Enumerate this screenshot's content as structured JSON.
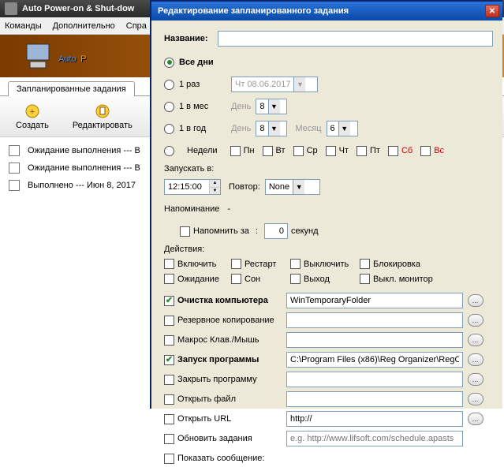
{
  "backWindow": {
    "title": "Auto Power-on & Shut-dow",
    "menu": [
      "Команды",
      "Дополнительно",
      "Спра"
    ],
    "bannerText": "Auto",
    "bannerTail": "P",
    "tabLabel": "Запланированные задания",
    "toolbar": {
      "create": "Создать",
      "edit": "Редактировать"
    },
    "listRows": [
      "Ожидание выполнения --- В",
      "Ожидание выполнения --- В",
      "Выполнено --- Июн 8,  2017"
    ]
  },
  "dialog": {
    "title": "Редактирование запланированного задания",
    "nameLabel": "Название:",
    "schedule": {
      "allDays": "Все дни",
      "once": "1 раз",
      "onceDate": "Чт 08.06.2017",
      "monthly": "1 в мес",
      "dayLbl": "День",
      "dayVal": "8",
      "yearly": "1 в год",
      "monthLbl": "Месяц",
      "monthVal": "6",
      "weekly": "Недели",
      "days": [
        "Пн",
        "Вт",
        "Ср",
        "Чт",
        "Пт",
        "Сб",
        "Вс"
      ]
    },
    "runAt": {
      "label": "Запускать в:",
      "time": "12:15:00",
      "repeatLbl": "Повтор:",
      "repeatVal": "None"
    },
    "remind": {
      "label": "Напоминание",
      "dash": "-",
      "chkLabel": "Напомнить за",
      "colon": ":",
      "val": "0",
      "unit": "секунд"
    },
    "actionsLabel": "Действия:",
    "actions": [
      [
        "Включить",
        "Рестарт",
        "Выключить",
        "Блокировка"
      ],
      [
        "Ожидание",
        "Сон",
        "Выход",
        "Выкл. монитор"
      ]
    ],
    "programs": [
      {
        "label": "Очистка компьютера",
        "checked": true,
        "bold": true,
        "value": "WinTemporaryFolder",
        "browse": true
      },
      {
        "label": "Резервное копирование",
        "checked": false,
        "bold": false,
        "value": "",
        "browse": true
      },
      {
        "label": "Макрос Клав./Мышь",
        "checked": false,
        "bold": false,
        "value": "",
        "browse": true
      },
      {
        "label": "Запуск программы",
        "checked": true,
        "bold": true,
        "value": "C:\\Program Files (x86)\\Reg Organizer\\RegO",
        "browse": true
      },
      {
        "label": "Закрыть программу",
        "checked": false,
        "bold": false,
        "value": "",
        "browse": true
      },
      {
        "label": "Открыть файл",
        "checked": false,
        "bold": false,
        "value": "",
        "browse": true
      },
      {
        "label": "Открыть URL",
        "checked": false,
        "bold": false,
        "value": "http://",
        "browse": true
      },
      {
        "label": "Обновить задания",
        "checked": false,
        "bold": false,
        "value": "",
        "placeholder": "e.g. http://www.lifsoft.com/schedule.apasts",
        "browse": false
      },
      {
        "label": "Показать сообщение:",
        "checked": false,
        "bold": false,
        "novalue": true
      }
    ]
  }
}
